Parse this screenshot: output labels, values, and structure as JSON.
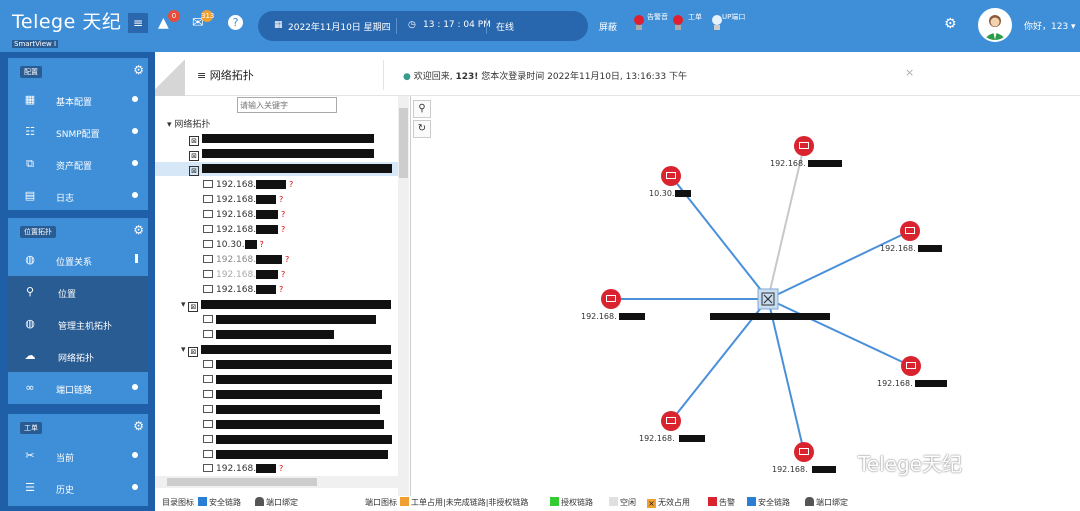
{
  "header": {
    "logo": "Telege 天纪",
    "logo_sub": "SmartView I",
    "alarm_badge": "0",
    "mail_badge": "313",
    "date": "2022年11月10日 星期四",
    "time": "13 : 17 : 04 PM",
    "status": "在线",
    "shield": "屏蔽",
    "bulb_alarm": "告警音",
    "bulb_order": "工单",
    "bulb_port": "UP端口",
    "greeting": "你好，123 ▾"
  },
  "sidebar": {
    "sections": [
      {
        "title": "配置",
        "items": [
          "基本配置",
          "SNMP配置",
          "资产配置",
          "日志"
        ]
      },
      {
        "title": "位置拓扑",
        "items": [
          "位置关系",
          "位置",
          "管理主机拓扑",
          "网络拓扑",
          "端口链路"
        ]
      },
      {
        "title": "工单",
        "items": [
          "当前",
          "历史"
        ]
      }
    ]
  },
  "tabs": {
    "title": "≡ 网络拓扑",
    "welcome_prefix": "欢迎回来,",
    "welcome_user": "123!",
    "welcome_text": "您本次登录时间 2022年11月10日, 13:16:33 下午",
    "close": "×"
  },
  "tree": {
    "search_placeholder": "请输入关键字",
    "root": "网络拓扑",
    "leaves": [
      "192.168.",
      "192.168.",
      "192.168.",
      "192.168.",
      "10.30.",
      "192.168.",
      "192.168.",
      "192.168.",
      "192.168."
    ]
  },
  "topology": {
    "center_label": "",
    "nodes": [
      "192.168.",
      "10.30.",
      "192.168.",
      "192.168.",
      "192.168.",
      "192.168.",
      "192.168.",
      "192.168."
    ]
  },
  "legend": {
    "dir_label": "目录图标",
    "safe_link": "安全链路",
    "port_bind": "端口绑定",
    "port_icon": "端口图标",
    "order_used": "工单占用|未完成链路|非授权链路",
    "auth_link": "授权链路",
    "idle": "空闲",
    "invalid": "无效占用",
    "alarm": "告警",
    "safe_link2": "安全链路",
    "port_bind2": "端口绑定"
  },
  "watermark": "Telege天纪",
  "colors": {
    "primary": "#3f8fd8",
    "dark": "#1f5fa8",
    "alarm": "#d9232e",
    "link": "#4a90d9"
  }
}
